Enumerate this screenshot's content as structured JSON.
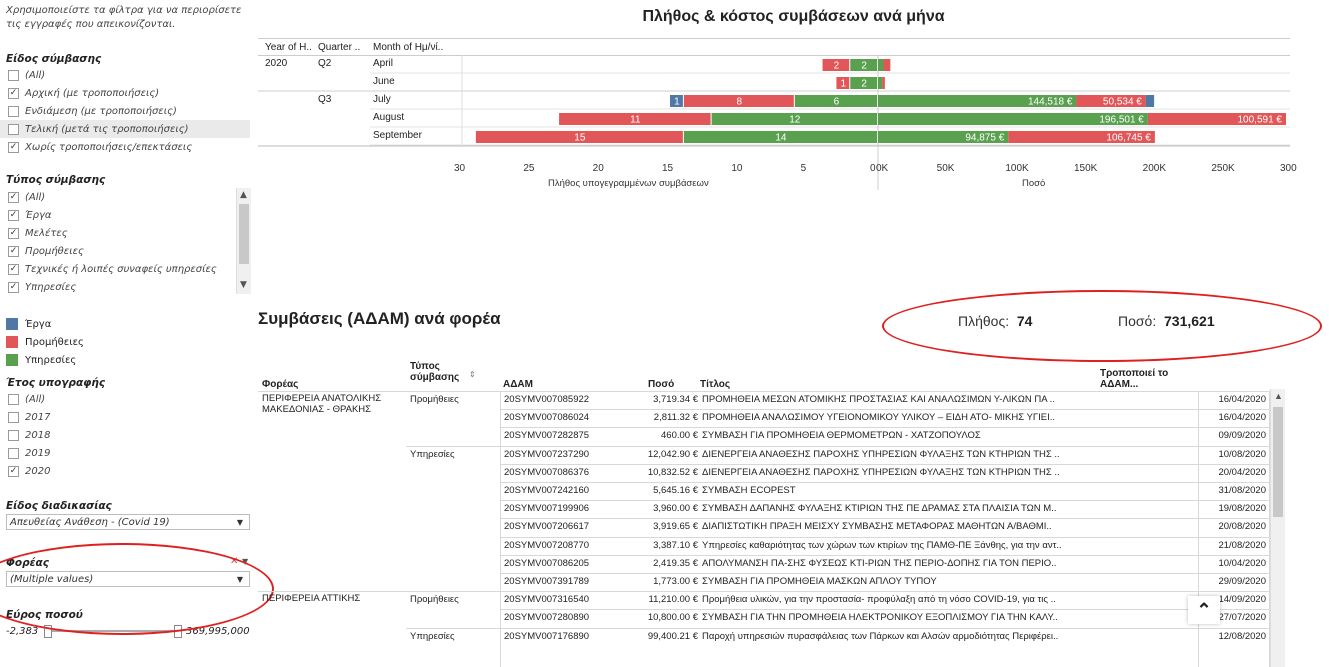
{
  "sidebar": {
    "hint": "Χρησιμοποιείστε τα φίλτρα για να περιορίσετε τις εγγραφές που απεικονίζονται.",
    "contract_kind": {
      "title": "Είδος σύμβασης",
      "items": [
        {
          "label": "(All)",
          "checked": false
        },
        {
          "label": "Αρχική (με τροποποιήσεις)",
          "checked": true
        },
        {
          "label": "Ενδιάμεση (με τροποποιήσεις)",
          "checked": false
        },
        {
          "label": "Τελική (μετά τις τροποποιήσεις)",
          "checked": false
        },
        {
          "label": "Χωρίς τροποποιήσεις/επεκτάσεις",
          "checked": true
        }
      ]
    },
    "contract_type": {
      "title": "Τύπος σύμβασης",
      "items": [
        {
          "label": "(All)",
          "checked": true
        },
        {
          "label": "Έργα",
          "checked": true
        },
        {
          "label": "Μελέτες",
          "checked": true
        },
        {
          "label": "Προμήθειες",
          "checked": true
        },
        {
          "label": "Τεχνικές ή λοιπές συναφείς υπηρεσίες",
          "checked": true
        },
        {
          "label": "Υπηρεσίες",
          "checked": true
        }
      ]
    },
    "legend": [
      {
        "label": "Έργα",
        "color": "#4e79a7"
      },
      {
        "label": "Προμήθειες",
        "color": "#e15759"
      },
      {
        "label": "Υπηρεσίες",
        "color": "#59a14f"
      }
    ],
    "year": {
      "title": "Έτος υπογραφής",
      "items": [
        {
          "label": "(All)",
          "checked": false
        },
        {
          "label": "2017",
          "checked": false
        },
        {
          "label": "2018",
          "checked": false
        },
        {
          "label": "2019",
          "checked": false
        },
        {
          "label": "2020",
          "checked": true
        }
      ]
    },
    "procedure": {
      "title": "Είδος διαδικασίας",
      "value": "Απευθείας Ανάθεση - (Covid 19)"
    },
    "agency": {
      "title": "Φορέας",
      "value": "(Multiple values)"
    },
    "amount_range": {
      "title": "Εύρος ποσού",
      "min": "-2,383",
      "max": "369,995,000"
    }
  },
  "chart": {
    "title": "Πλήθος & κόστος συμβάσεων ανά μήνα",
    "headers": [
      "Year of H..",
      "Quarter ..",
      "Month of Ημ/νί.."
    ],
    "year": "2020",
    "quarters": [
      "Q2",
      "Q3"
    ],
    "months": [
      "April",
      "June",
      "July",
      "August",
      "September"
    ],
    "left_axis_label": "Πλήθος υπογεγραμμένων συμβάσεων",
    "right_axis_label": "Ποσό",
    "left_ticks": [
      "30",
      "25",
      "20",
      "15",
      "10",
      "5",
      "0"
    ],
    "right_ticks": [
      "0K",
      "50K",
      "100K",
      "150K",
      "200K",
      "250K",
      "300"
    ]
  },
  "chart_data": {
    "type": "bar",
    "title": "Πλήθος & κόστος συμβάσεων ανά μήνα",
    "categories": [
      "April",
      "June",
      "July",
      "August",
      "September"
    ],
    "count_series": [
      {
        "name": "Υπηρεσίες",
        "values": [
          2,
          2,
          6,
          12,
          14
        ]
      },
      {
        "name": "Προμήθειες",
        "values": [
          2,
          1,
          8,
          11,
          15
        ]
      },
      {
        "name": "Έργα",
        "values": [
          0,
          0,
          1,
          0,
          0
        ]
      }
    ],
    "amount_series": [
      {
        "name": "Υπηρεσίες",
        "values": [
          4000,
          3000,
          144518,
          196501,
          94875
        ]
      },
      {
        "name": "Προμήθειες",
        "values": [
          5000,
          2000,
          50534,
          100591,
          106745
        ]
      },
      {
        "name": "Έργα",
        "values": [
          0,
          0,
          6000,
          0,
          0
        ]
      }
    ],
    "amount_labels": [
      [
        "",
        ""
      ],
      [
        "",
        ""
      ],
      [
        "144,518 €",
        "50,534 €"
      ],
      [
        "196,501 €",
        "100,591 €"
      ],
      [
        "94,875 €",
        "106,745 €"
      ]
    ],
    "xlim_count": [
      30,
      0
    ],
    "xlim_amount": [
      0,
      300000
    ],
    "xlabel_left": "Πλήθος υπογεγραμμένων συμβάσεων",
    "xlabel_right": "Ποσό"
  },
  "table_section": {
    "title": "Συμβάσεις (ΑΔΑΜ) ανά φορέα",
    "kpi_count_label": "Πλήθος:",
    "kpi_count_value": "74",
    "kpi_amount_label": "Ποσό:",
    "kpi_amount_value": "731,621",
    "headers": {
      "agency": "Φορέας",
      "type": "Τύπος σύμβασης",
      "adam": "ΑΔΑΜ",
      "amount": "Ποσό",
      "title": "Τίτλος",
      "modifies": "Τροποποιεί το ΑΔΑΜ..."
    },
    "groups": [
      {
        "agency": "ΠΕΡΙΦΕΡΕΙΑ ΑΝΑΤΟΛΙΚΗΣ ΜΑΚΕΔΟΝΙΑΣ - ΘΡΑΚΗΣ",
        "subgroups": [
          {
            "type": "Προμήθειες",
            "rows": [
              {
                "adam": "20SYMV007085922",
                "amount": "3,719.34 €",
                "title": "ΠΡΟΜΗΘΕΙΑ ΜΕΣΩΝ ΑΤΟΜΙΚΗΣ ΠΡΟΣΤΑΣΙΑΣ ΚΑΙ ΑΝΑΛΩΣΙΜΩΝ Υ-ΛΙΚΩΝ ΠΑ ..",
                "date": "16/04/2020"
              },
              {
                "adam": "20SYMV007086024",
                "amount": "2,811.32 €",
                "title": "ΠΡΟΜΗΘΕΙΑ ΑΝΑΛΩΣΙΜΟΥ ΥΓΕΙΟΝΟΜΙΚΟΥ ΥΛΙΚΟΥ – ΕΙΔΗ ΑΤΟ- ΜΙΚΗΣ ΥΓΙΕΙ..",
                "date": "16/04/2020"
              },
              {
                "adam": "20SYMV007282875",
                "amount": "460.00 €",
                "title": "ΣΥΜΒΑΣΗ ΓΙΑ ΠΡΟΜΗΘΕΙΑ ΘΕΡΜΟΜΕΤΡΩΝ - ΧΑΤΖΟΠΟΥΛΟΣ",
                "date": "09/09/2020"
              }
            ]
          },
          {
            "type": "Υπηρεσίες",
            "rows": [
              {
                "adam": "20SYMV007237290",
                "amount": "12,042.90 €",
                "title": "ΔΙΕΝΕΡΓΕΙΑ ΑΝΑΘΕΣΗΣ ΠΑΡΟΧΗΣ ΥΠΗΡΕΣΙΩΝ ΦΥΛΑΞΗΣ ΤΩΝ ΚΤΗΡΙΩΝ ΤΗΣ ..",
                "date": "10/08/2020"
              },
              {
                "adam": "20SYMV007086376",
                "amount": "10,832.52 €",
                "title": "ΔΙΕΝΕΡΓΕΙΑ ΑΝΑΘΕΣΗΣ ΠΑΡΟΧΗΣ ΥΠΗΡΕΣΙΩΝ ΦΥΛΑΞΗΣ ΤΩΝ ΚΤΗΡΙΩΝ ΤΗΣ ..",
                "date": "20/04/2020"
              },
              {
                "adam": "20SYMV007242160",
                "amount": "5,645.16 €",
                "title": "ΣΥΜΒΑΣΗ ECOPEST",
                "date": "31/08/2020"
              },
              {
                "adam": "20SYMV007199906",
                "amount": "3,960.00 €",
                "title": "ΣΥΜΒΑΣΗ ΔΑΠΑΝΗΣ ΦΥΛΑΞΗΣ ΚΤΙΡΙΩΝ ΤΗΣ ΠΕ ΔΡΑΜΑΣ ΣΤΑ ΠΛΑΙΣΙΑ ΤΩΝ Μ..",
                "date": "19/08/2020"
              },
              {
                "adam": "20SYMV007206617",
                "amount": "3,919.65 €",
                "title": "ΔΙΑΠΙΣΤΩΤΙΚΗ ΠΡΑΞΗ ΜΕΙΣΧΥ ΣΥΜΒΑΣΗΣ ΜΕΤΑΦΟΡΑΣ ΜΑΘΗΤΩΝ Α/ΒΑΘΜΙ..",
                "date": "20/08/2020"
              },
              {
                "adam": "20SYMV007208770",
                "amount": "3,387.10 €",
                "title": "Υπηρεσίες καθαριότητας των χώρων των κτιρίων της ΠΑΜΘ-ΠΕ Ξάνθης, για την αντ..",
                "date": "21/08/2020"
              },
              {
                "adam": "20SYMV007086205",
                "amount": "2,419.35 €",
                "title": "ΑΠΟΛΥΜΑΝΣΗ ΠΑ-ΣΗΣ ΦΥΣΕΩΣ ΚΤΙ-ΡΙΩΝ ΤΗΣ ΠΕΡΙΟ-ΔΟΠΗΣ ΓΙΑ ΤΟΝ ΠΕΡΙΟ..",
                "date": "10/04/2020"
              },
              {
                "adam": "20SYMV007391789",
                "amount": "1,773.00 €",
                "title": "ΣΥΜΒΑΣΗ ΓΙΑ ΠΡΟΜΗΘΕΙΑ ΜΑΣΚΩΝ ΑΠΛΟΥ ΤΥΠΟΥ",
                "date": "29/09/2020"
              }
            ]
          }
        ]
      },
      {
        "agency": "ΠΕΡΙΦΕΡΕΙΑ ΑΤΤΙΚΗΣ",
        "subgroups": [
          {
            "type": "Προμήθειες",
            "rows": [
              {
                "adam": "20SYMV007316540",
                "amount": "11,210.00 €",
                "title": "Προμήθεια υλικών, για την προστασία- προφύλαξη από τη νόσο COVID-19, για τις ..",
                "date": "14/09/2020"
              },
              {
                "adam": "20SYMV007280890",
                "amount": "10,800.00 €",
                "title": "ΣΥΜΒΑΣΗ ΓΙΑ ΤΗΝ ΠΡΟΜΗΘΕΙΑ ΗΛΕΚΤΡΟΝΙΚΟΥ ΕΞΟΠΛΙΣΜΟΥ ΓΙΑ ΤΗΝ ΚΑΛΥ..",
                "date": "27/07/2020"
              }
            ]
          },
          {
            "type": "Υπηρεσίες",
            "rows": [
              {
                "adam": "20SYMV007176890",
                "amount": "99,400.21 €",
                "title": "Παροχή υπηρεσιών πυρασφάλειας των Πάρκων και Αλσών αρμοδιότητας Περιφέρει..",
                "date": "12/08/2020"
              }
            ]
          }
        ]
      }
    ]
  }
}
